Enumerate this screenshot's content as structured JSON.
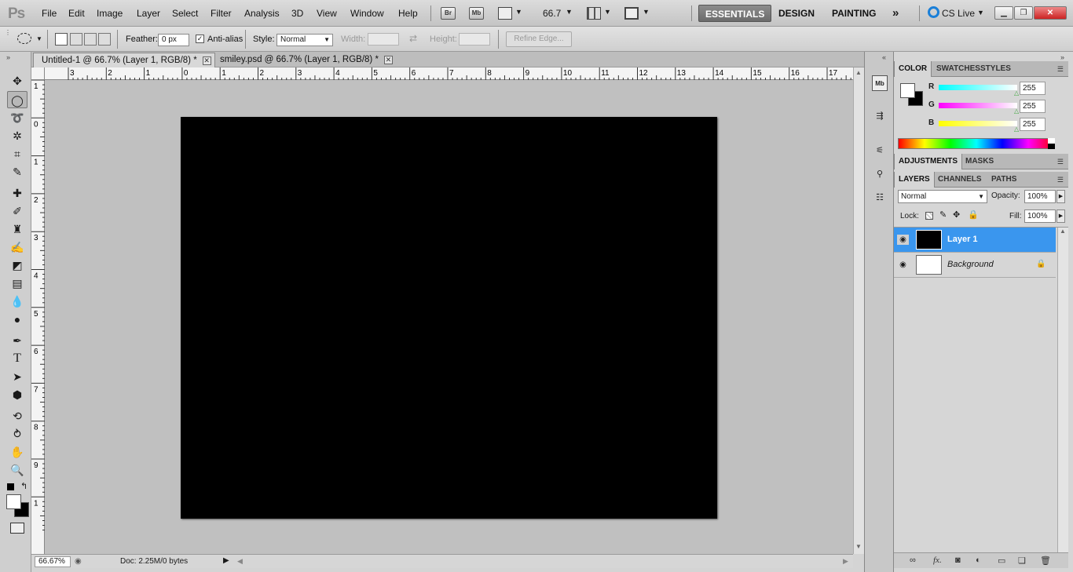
{
  "app": {
    "logo": "Ps"
  },
  "menu": [
    "File",
    "Edit",
    "Image",
    "Layer",
    "Select",
    "Filter",
    "Analysis",
    "3D",
    "View",
    "Window",
    "Help"
  ],
  "menubar_buttons": {
    "bridge": "Br",
    "mini_bridge": "Mb",
    "zoom": "66.7"
  },
  "workspaces": [
    "ESSENTIALS",
    "DESIGN",
    "PAINTING"
  ],
  "cs_live": "CS Live",
  "options": {
    "feather_label": "Feather:",
    "feather_value": "0 px",
    "antialias_label": "Anti-alias",
    "style_label": "Style:",
    "style_value": "Normal",
    "width_label": "Width:",
    "height_label": "Height:",
    "refine_edge": "Refine Edge..."
  },
  "tabs": [
    {
      "label": "Untitled-1 @ 66.7% (Layer 1, RGB/8) *",
      "active": true
    },
    {
      "label": "smiley.psd @ 66.7% (Layer 1, RGB/8) *",
      "active": false
    }
  ],
  "ruler": {
    "h_ticks": [
      "3",
      "2",
      "1",
      "0",
      "1",
      "2",
      "3",
      "4",
      "5",
      "6",
      "7",
      "8",
      "9",
      "10",
      "11",
      "12",
      "13",
      "14",
      "15",
      "16",
      "17"
    ],
    "v_ticks": [
      "1",
      "0",
      "1",
      "2",
      "3",
      "4",
      "5",
      "6",
      "7",
      "8",
      "9",
      "1"
    ]
  },
  "status": {
    "zoom": "66.67%",
    "doc": "Doc: 2.25M/0 bytes"
  },
  "color_panel": {
    "tabs": [
      "COLOR",
      "SWATCHES",
      "STYLES"
    ],
    "r_label": "R",
    "r_value": "255",
    "g_label": "G",
    "g_value": "255",
    "b_label": "B",
    "b_value": "255"
  },
  "adjust_panel": {
    "tabs": [
      "ADJUSTMENTS",
      "MASKS"
    ]
  },
  "layers_panel": {
    "tabs": [
      "LAYERS",
      "CHANNELS",
      "PATHS"
    ],
    "blend_mode": "Normal",
    "opacity_label": "Opacity:",
    "opacity_value": "100%",
    "lock_label": "Lock:",
    "fill_label": "Fill:",
    "fill_value": "100%",
    "layers": [
      {
        "name": "Layer 1",
        "selected": true
      },
      {
        "name": "Background",
        "selected": false
      }
    ]
  },
  "colors": {
    "accent": "#3a96ee",
    "canvas_bg": "#c0c0c0",
    "document": "#000000"
  }
}
